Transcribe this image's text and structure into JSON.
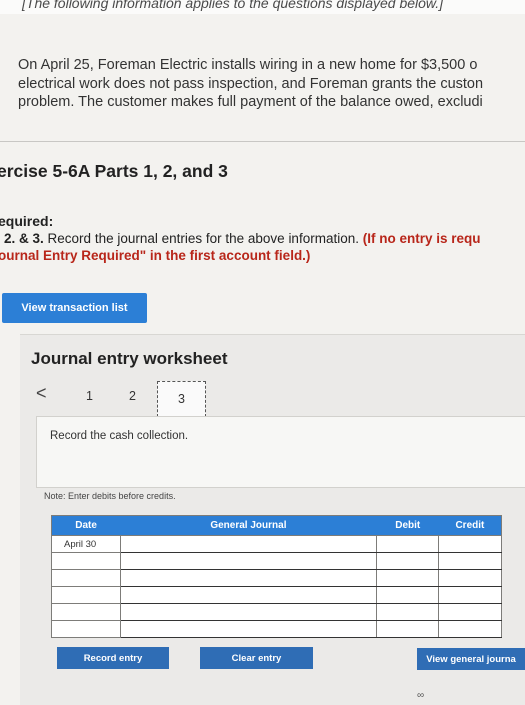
{
  "banner": "[The following information applies to the questions displayed below.]",
  "problem_lines": [
    "On April 25, Foreman Electric installs wiring in a new home for $3,500 o",
    "electrical work does not pass inspection, and Foreman grants the custon",
    "problem. The customer makes full payment of the balance owed, excludi"
  ],
  "exercise_title": "ercise 5-6A Parts 1, 2, and 3",
  "required": {
    "label": "equired:",
    "prefix": "2. & 3.",
    "text": "Record the journal entries for the above information.",
    "red_text": "(If no entry is requ",
    "red_line2": "ournal Entry Required\" in the first account field.)"
  },
  "view_transaction_list": "View transaction list",
  "worksheet": {
    "title": "Journal entry worksheet",
    "prev": "<",
    "steps": [
      "1",
      "2",
      "3"
    ],
    "description": "Record the cash collection.",
    "note": "Note: Enter debits before credits.",
    "columns": [
      "Date",
      "General Journal",
      "Debit",
      "Credit"
    ],
    "rows": [
      {
        "date": "April 30",
        "account": "",
        "debit": "",
        "credit": ""
      },
      {
        "date": "",
        "account": "",
        "debit": "",
        "credit": ""
      },
      {
        "date": "",
        "account": "",
        "debit": "",
        "credit": ""
      },
      {
        "date": "",
        "account": "",
        "debit": "",
        "credit": ""
      },
      {
        "date": "",
        "account": "",
        "debit": "",
        "credit": ""
      },
      {
        "date": "",
        "account": "",
        "debit": "",
        "credit": ""
      }
    ],
    "buttons": {
      "record": "Record entry",
      "clear": "Clear entry",
      "view_general": "View general journa"
    }
  },
  "colors": {
    "accent_blue": "#2c7fd6",
    "required_red": "#b8261a"
  }
}
